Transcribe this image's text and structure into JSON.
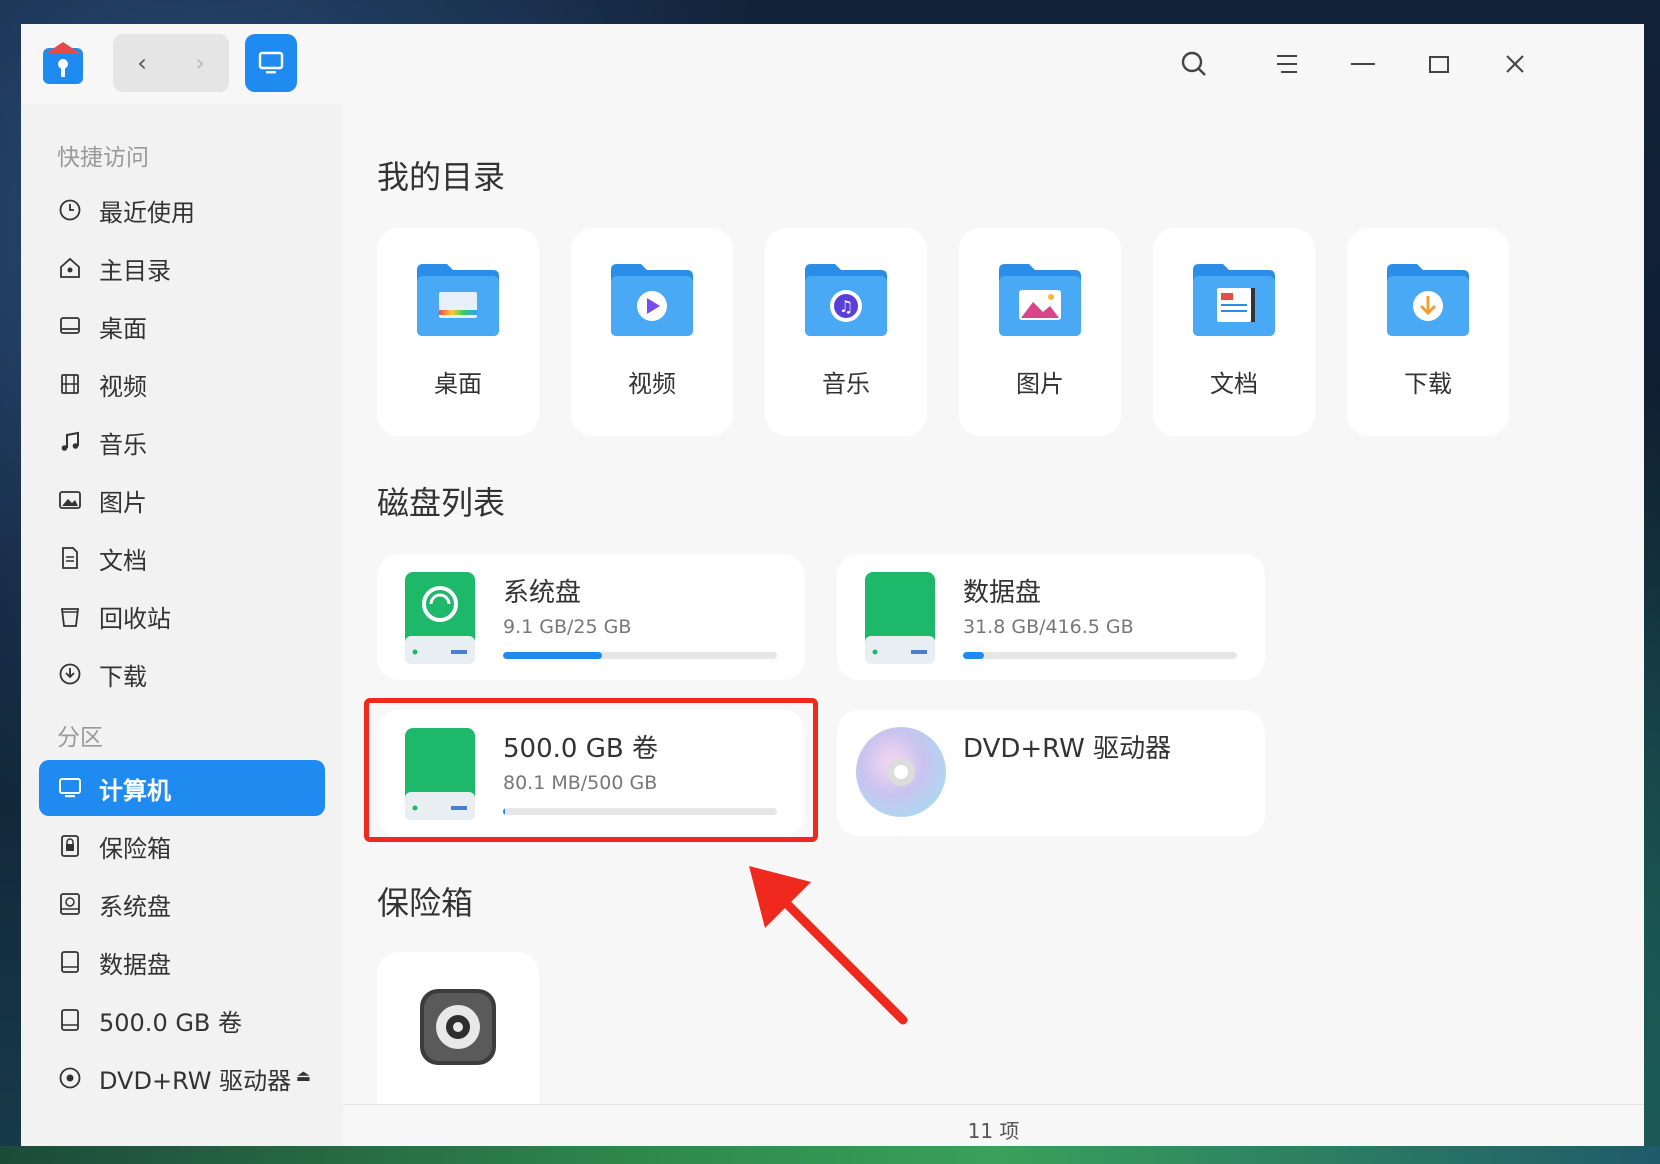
{
  "titlebar": {
    "icons": [
      "app-logo-icon",
      "back-icon",
      "forward-icon",
      "computer-view-icon",
      "search-icon",
      "menu-icon",
      "minimize-icon",
      "maximize-icon",
      "close-icon"
    ]
  },
  "sidebar": {
    "quick_access_heading": "快捷访问",
    "quick_items": [
      {
        "label": "最近使用",
        "icon": "clock-icon"
      },
      {
        "label": "主目录",
        "icon": "home-icon"
      },
      {
        "label": "桌面",
        "icon": "desktop-icon"
      },
      {
        "label": "视频",
        "icon": "video-icon"
      },
      {
        "label": "音乐",
        "icon": "music-icon"
      },
      {
        "label": "图片",
        "icon": "picture-icon"
      },
      {
        "label": "文档",
        "icon": "document-icon"
      },
      {
        "label": "回收站",
        "icon": "trash-icon"
      },
      {
        "label": "下载",
        "icon": "download-icon"
      }
    ],
    "partition_heading": "分区",
    "partition_items": [
      {
        "label": "计算机",
        "icon": "computer-icon",
        "active": true
      },
      {
        "label": "保险箱",
        "icon": "safe-icon"
      },
      {
        "label": "系统盘",
        "icon": "system-disk-icon"
      },
      {
        "label": "数据盘",
        "icon": "disk-icon"
      },
      {
        "label": "500.0 GB 卷",
        "icon": "disk-icon"
      },
      {
        "label": "DVD+RW 驱动器",
        "icon": "optical-disc-icon"
      }
    ]
  },
  "main": {
    "my_dirs_title": "我的目录",
    "folders": [
      {
        "label": "桌面",
        "icon": "desktop-folder-icon"
      },
      {
        "label": "视频",
        "icon": "video-folder-icon"
      },
      {
        "label": "音乐",
        "icon": "music-folder-icon"
      },
      {
        "label": "图片",
        "icon": "picture-folder-icon"
      },
      {
        "label": "文档",
        "icon": "document-folder-icon"
      },
      {
        "label": "下载",
        "icon": "download-folder-icon"
      }
    ],
    "disk_list_title": "磁盘列表",
    "disks": [
      {
        "name": "系统盘",
        "size": "9.1 GB/25 GB",
        "usage": 0.36
      },
      {
        "name": "数据盘",
        "size": "31.8 GB/416.5 GB",
        "usage": 0.076
      },
      {
        "name": "500.0 GB 卷",
        "size": "80.1 MB/500 GB",
        "usage": 0.002
      },
      {
        "name": "DVD+RW 驱动器",
        "size": "",
        "usage": null
      }
    ],
    "safe_title": "保险箱"
  },
  "status": {
    "item_count": "11 项"
  },
  "colors": {
    "accent": "#1f8bf0",
    "highlight": "#f0291f",
    "disk_green": "#1db86a"
  }
}
